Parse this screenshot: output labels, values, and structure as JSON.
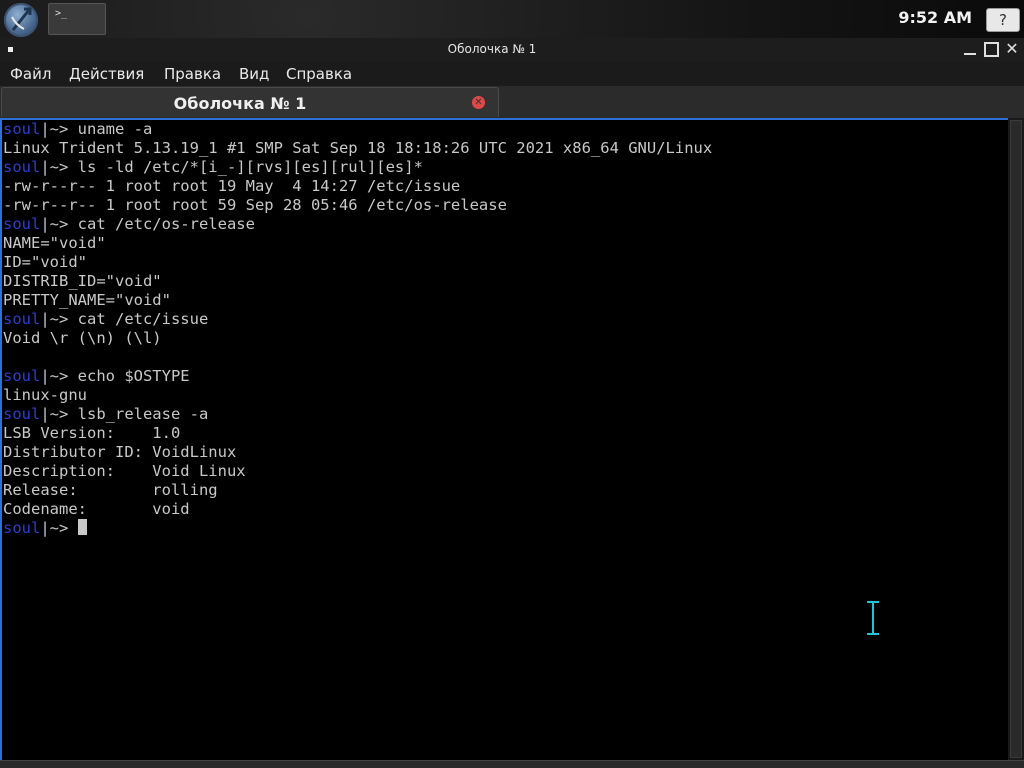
{
  "panel": {
    "clock": "9:52 AM",
    "help_label": "?",
    "task_button_label": ">_",
    "launcher_icon": "trident-logo-icon",
    "terminal_task_icon": "terminal-icon"
  },
  "window": {
    "title": "Оболочка № 1",
    "close_glyph": "✕"
  },
  "menu": {
    "items": [
      "Файл",
      "Действия",
      "Правка",
      "Вид",
      "Справка"
    ]
  },
  "tab": {
    "title": "Оболочка № 1",
    "close_glyph": "✕"
  },
  "terminal": {
    "prompt_user": "soul",
    "prompt_rest": "|~> ",
    "lines": [
      {
        "type": "prompt",
        "cmd": "uname -a"
      },
      {
        "type": "out",
        "text": "Linux Trident 5.13.19_1 #1 SMP Sat Sep 18 18:18:26 UTC 2021 x86_64 GNU/Linux"
      },
      {
        "type": "prompt",
        "cmd": "ls -ld /etc/*[i_-][rvs][es][rul][es]*"
      },
      {
        "type": "out",
        "text": "-rw-r--r-- 1 root root 19 May  4 14:27 /etc/issue"
      },
      {
        "type": "out",
        "text": "-rw-r--r-- 1 root root 59 Sep 28 05:46 /etc/os-release"
      },
      {
        "type": "prompt",
        "cmd": "cat /etc/os-release"
      },
      {
        "type": "out",
        "text": "NAME=\"void\""
      },
      {
        "type": "out",
        "text": "ID=\"void\""
      },
      {
        "type": "out",
        "text": "DISTRIB_ID=\"void\""
      },
      {
        "type": "out",
        "text": "PRETTY_NAME=\"void\""
      },
      {
        "type": "prompt",
        "cmd": "cat /etc/issue"
      },
      {
        "type": "out",
        "text": "Void \\r (\\n) (\\l)"
      },
      {
        "type": "out",
        "text": ""
      },
      {
        "type": "prompt",
        "cmd": "echo $OSTYPE"
      },
      {
        "type": "out",
        "text": "linux-gnu"
      },
      {
        "type": "prompt",
        "cmd": "lsb_release -a"
      },
      {
        "type": "out",
        "text": "LSB Version:    1.0"
      },
      {
        "type": "out",
        "text": "Distributor ID: VoidLinux"
      },
      {
        "type": "out",
        "text": "Description:    Void Linux"
      },
      {
        "type": "out",
        "text": "Release:        rolling"
      },
      {
        "type": "out",
        "text": "Codename:       void"
      },
      {
        "type": "prompt",
        "cmd": "",
        "cursor": true
      }
    ]
  },
  "colors": {
    "prompt_user": "#2b3fd0",
    "terminal_text": "#c8c8c8",
    "terminal_bg": "#000000",
    "focus_border": "#2f6fd8",
    "tab_close": "#e04848",
    "ibeam": "#22c4d8"
  }
}
